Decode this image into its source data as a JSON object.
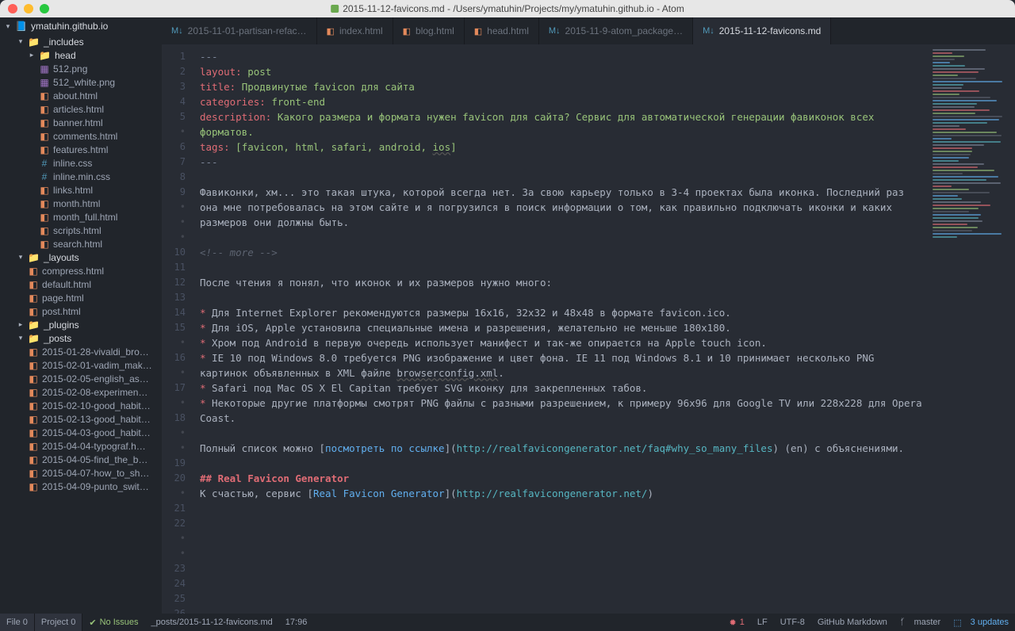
{
  "window": {
    "title": "2015-11-12-favicons.md - /Users/ymatuhin/Projects/my/ymatuhin.github.io - Atom"
  },
  "project": {
    "root": "ymatuhin.github.io"
  },
  "tree": {
    "includes": {
      "name": "_includes",
      "children": {
        "head": {
          "name": "head",
          "children": [
            {
              "name": "512.png",
              "type": "png"
            },
            {
              "name": "512_white.png",
              "type": "png"
            },
            {
              "name": "about.html",
              "type": "html"
            },
            {
              "name": "articles.html",
              "type": "html"
            },
            {
              "name": "banner.html",
              "type": "html"
            },
            {
              "name": "comments.html",
              "type": "html"
            },
            {
              "name": "features.html",
              "type": "html"
            },
            {
              "name": "inline.css",
              "type": "css"
            },
            {
              "name": "inline.min.css",
              "type": "css"
            },
            {
              "name": "links.html",
              "type": "html"
            },
            {
              "name": "month.html",
              "type": "html"
            },
            {
              "name": "month_full.html",
              "type": "html"
            },
            {
              "name": "scripts.html",
              "type": "html"
            },
            {
              "name": "search.html",
              "type": "html"
            }
          ]
        }
      }
    },
    "layouts": {
      "name": "_layouts",
      "children": [
        {
          "name": "compress.html",
          "type": "html"
        },
        {
          "name": "default.html",
          "type": "html"
        },
        {
          "name": "page.html",
          "type": "html"
        },
        {
          "name": "post.html",
          "type": "html"
        }
      ]
    },
    "plugins": {
      "name": "_plugins"
    },
    "posts": {
      "name": "_posts",
      "children": [
        {
          "name": "2015-01-28-vivaldi_bro…",
          "type": "html"
        },
        {
          "name": "2015-02-01-vadim_mak…",
          "type": "html"
        },
        {
          "name": "2015-02-05-english_as…",
          "type": "html"
        },
        {
          "name": "2015-02-08-experimen…",
          "type": "html"
        },
        {
          "name": "2015-02-10-good_habit…",
          "type": "html"
        },
        {
          "name": "2015-02-13-good_habit…",
          "type": "html"
        },
        {
          "name": "2015-04-03-good_habit…",
          "type": "html"
        },
        {
          "name": "2015-04-04-typograf.h…",
          "type": "html"
        },
        {
          "name": "2015-04-05-find_the_b…",
          "type": "html"
        },
        {
          "name": "2015-04-07-how_to_sh…",
          "type": "html"
        },
        {
          "name": "2015-04-09-punto_swit…",
          "type": "html"
        }
      ]
    }
  },
  "tabs": [
    {
      "label": "2015-11-01-partisan-refac…",
      "icon": "md"
    },
    {
      "label": "index.html",
      "icon": "html"
    },
    {
      "label": "blog.html",
      "icon": "html"
    },
    {
      "label": "head.html",
      "icon": "html"
    },
    {
      "label": "2015-11-9-atom_package…",
      "icon": "md"
    },
    {
      "label": "2015-11-12-favicons.md",
      "icon": "md",
      "active": true
    }
  ],
  "editor": {
    "fm": {
      "dash": "---",
      "layout_k": "layout:",
      "layout_v": "post",
      "title_k": "title:",
      "title_v": "Продвинутые favicon для сайта",
      "cat_k": "categories:",
      "cat_v": "front-end",
      "desc_k": "description:",
      "desc_v": "Какого размера и формата нужен favicon для сайта? Сервис для автоматической генерации фавиконок всех форматов.",
      "tags_k": "tags:",
      "tags_v1": "[favicon, html, safari, android, ",
      "tags_ios": "ios",
      "tags_v2": "]"
    },
    "p1": "Фавиконки, хм... это такая штука, которой всегда нет. За свою карьеру только в 3-4 проектах была иконка. Последний раз она мне потребовалась на этом сайте и я погрузился в поиск информации о том, как правильно подключать иконки и каких размеров они должны быть.",
    "more": "<!-- more -->",
    "p2": "После чтения я понял, что иконок и их размеров нужно много:",
    "b1": " Для Internet Explorer рекомендуются размеры 16x16, 32x32 и 48x48 в формате favicon.ico.",
    "b2": " Для iOS, Apple установила специальные имена и разрешения, желательно не меньше 180x180.",
    "b3": " Хром под Android в первую очередь использует манифест и так-же опирается на Apple touch icon.",
    "b4a": " IE 10 под Windows 8.0 требуется PNG изображение и цвет фона. IE 11 под Windows 8.1 и 10 принимает несколько PNG картинок объявленных в XML файле ",
    "b4b": "browserconfig.xml",
    "b5": " Safari под Mac OS X El Capitan требует SVG иконку для закрепленных табов.",
    "b6": " Некоторые другие платформы смотрят PNG файлы с разными разрешением, к примеру 96x96 для Google TV или 228x228 для Opera Coast.",
    "link1a": "Полный список можно [",
    "link1b": "посмотреть по ссылке",
    "link1c": "](",
    "link1d": "http://realfavicongenerator.net/faq#why_so_many_files",
    "link1e": ") (en) с объяснениями.",
    "h2": "## Real Favicon Generator",
    "l2a": "К счастью, сервис [",
    "l2b": "Real Favicon Generator",
    "l2c": "](",
    "l2d": "http://realfavicongenerator.net/",
    "l2e": ")"
  },
  "status": {
    "file": "File",
    "file_n": "0",
    "project": "Project",
    "project_n": "0",
    "issues": "No Issues",
    "path": "_posts/2015-11-12-favicons.md",
    "pos": "17:96",
    "err": "1",
    "lf": "LF",
    "enc": "UTF-8",
    "grammar": "GitHub Markdown",
    "branch": "master",
    "updates": "3 updates"
  }
}
